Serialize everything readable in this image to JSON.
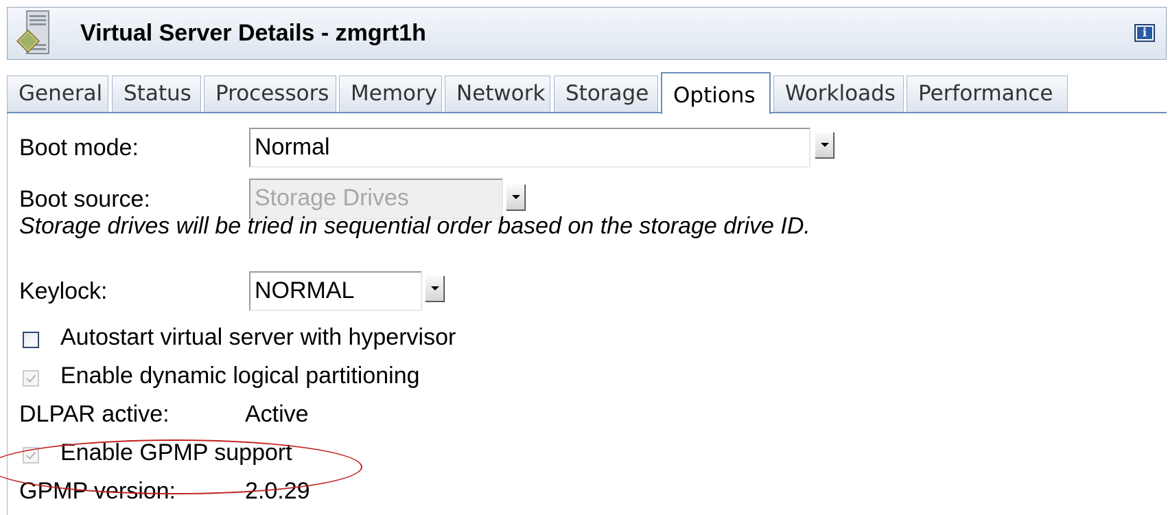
{
  "titlebar": {
    "title": "Virtual Server Details - zmgrt1h",
    "server_icon": "server-icon",
    "info_icon_glyph": "i"
  },
  "tabs": [
    {
      "label": "General"
    },
    {
      "label": "Status"
    },
    {
      "label": "Processors"
    },
    {
      "label": "Memory"
    },
    {
      "label": "Network"
    },
    {
      "label": "Storage"
    },
    {
      "label": "Options",
      "active": true
    },
    {
      "label": "Workloads"
    },
    {
      "label": "Performance"
    }
  ],
  "options": {
    "boot_mode_label": "Boot mode:",
    "boot_mode_value": "Normal",
    "boot_source_label": "Boot source:",
    "boot_source_value": "Storage Drives",
    "boot_note": "Storage drives will be tried in sequential order based on the storage drive ID.",
    "keylock_label": "Keylock:",
    "keylock_value": "NORMAL",
    "autostart_label": "Autostart virtual server with hypervisor",
    "autostart_checked": false,
    "dlpar_enable_label": "Enable dynamic logical partitioning",
    "dlpar_enable_checked": true,
    "dlpar_active_label": "DLPAR active:",
    "dlpar_active_value": "Active",
    "gpmp_enable_label": "Enable GPMP support",
    "gpmp_enable_checked": true,
    "gpmp_version_label": "GPMP version:",
    "gpmp_version_value": "2.0.29"
  },
  "colors": {
    "highlight": "#c41c1c",
    "tab_border": "#6c8fb9"
  }
}
